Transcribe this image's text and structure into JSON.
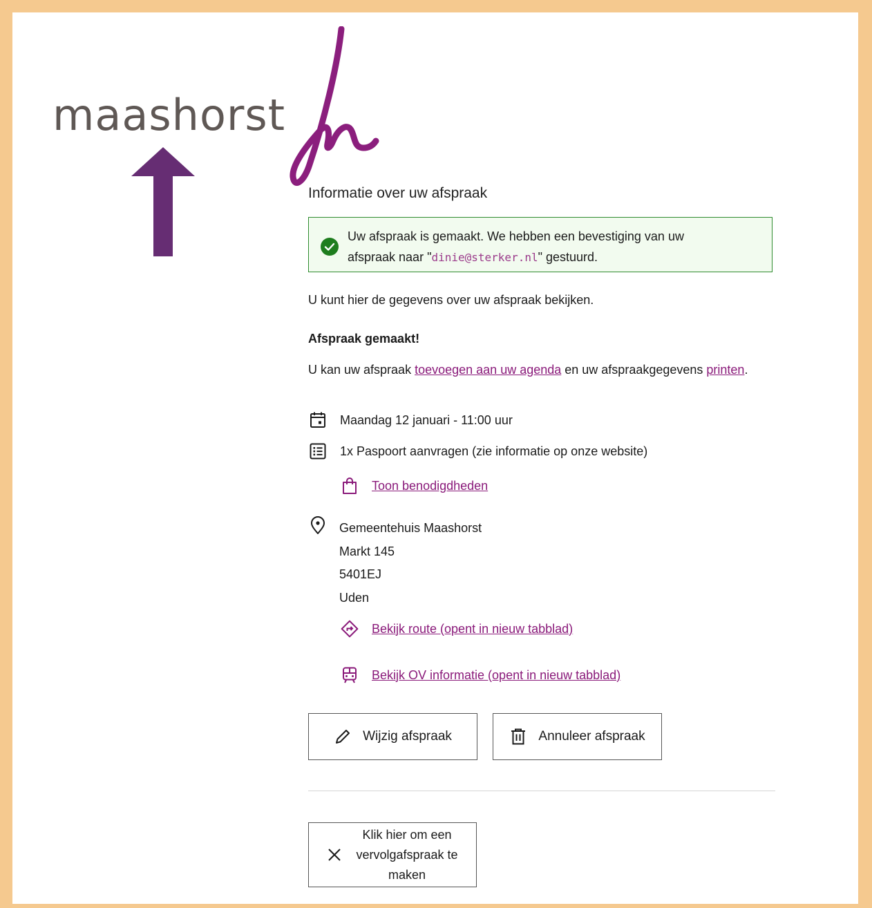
{
  "brand": {
    "logo_text": "maashorst"
  },
  "page": {
    "title": "Informatie over uw afspraak"
  },
  "alert": {
    "text_before": "Uw afspraak is gemaakt. We hebben een bevestiging van uw afspraak naar \"",
    "email": "dinie@sterker.nl",
    "text_after": "\" gestuurd."
  },
  "intro": "U kunt hier de gegevens over uw afspraak bekijken.",
  "section_heading": "Afspraak gemaakt!",
  "instructions": {
    "part1": "U kan uw afspraak ",
    "link_agenda": "toevoegen aan uw agenda",
    "part2": " en uw afspraakgegevens ",
    "link_print": "printen",
    "part3": "."
  },
  "appointment": {
    "datetime": "Maandag 12 januari - 11:00 uur",
    "product": "1x Paspoort aanvragen (zie informatie op onze website)",
    "requirements_link": "Toon benodigdheden",
    "location": {
      "name": "Gemeentehuis Maashorst",
      "street": "Markt 145",
      "postcode": "5401EJ",
      "city": "Uden"
    },
    "route_link": "Bekijk route (opent in nieuw tabblad)",
    "ov_link": "Bekijk OV informatie (opent in nieuw tabblad)"
  },
  "buttons": {
    "edit": "Wijzig afspraak",
    "cancel": "Annuleer afspraak",
    "followup": "Klik hier om een vervolgafspraak te maken"
  },
  "colors": {
    "accent": "#8a1a7a",
    "success_border": "#2e8b2e",
    "frame": "#f5c98f",
    "arrow": "#662d73"
  }
}
